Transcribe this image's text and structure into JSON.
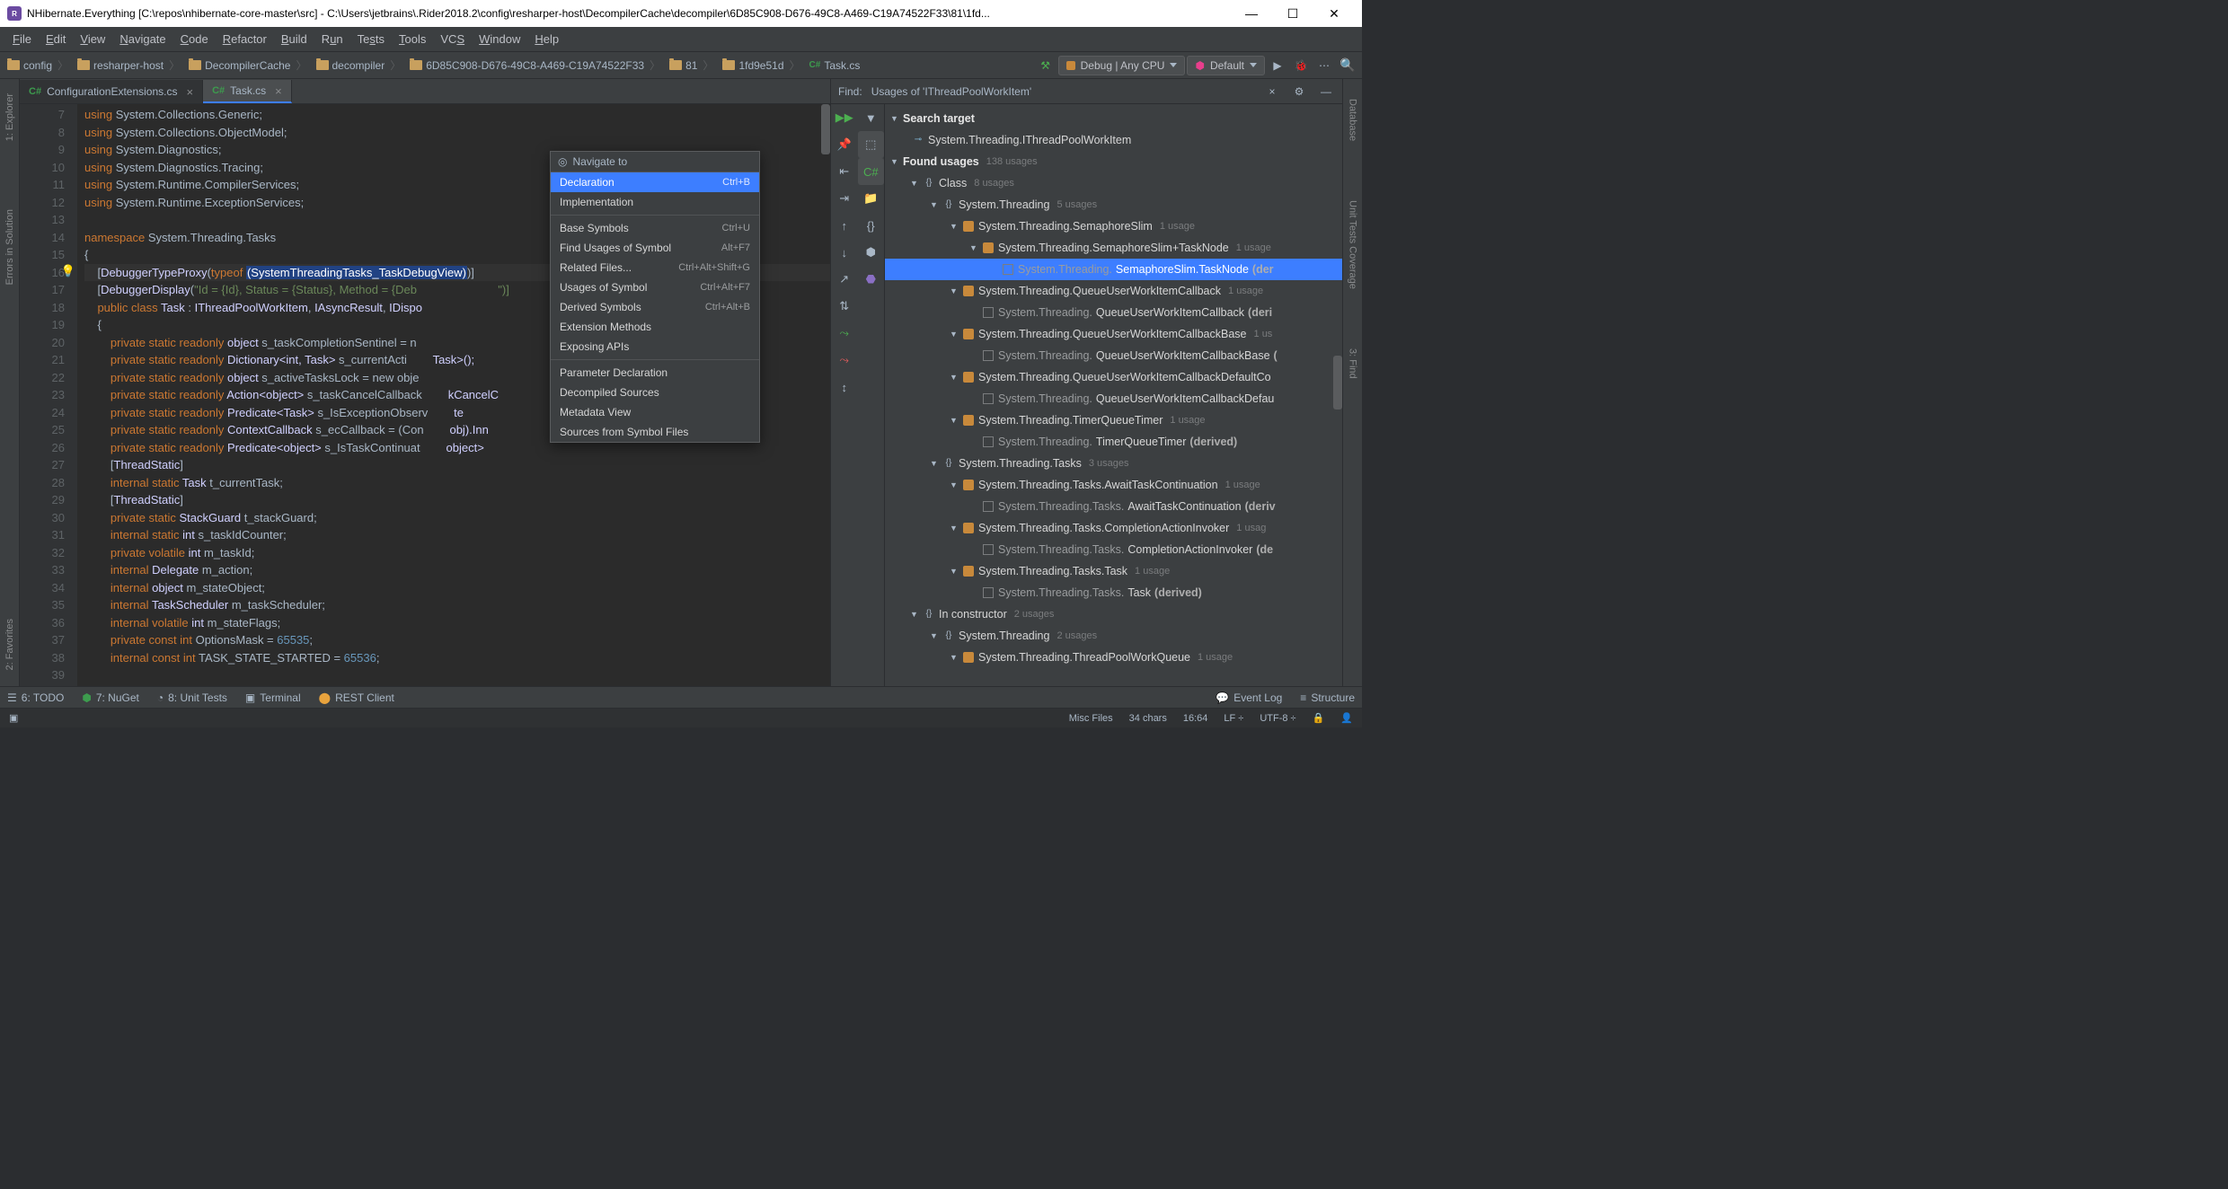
{
  "titlebar": {
    "title": "NHibernate.Everything [C:\\repos\\nhibernate-core-master\\src] - C:\\Users\\jetbrains\\.Rider2018.2\\config\\resharper-host\\DecompilerCache\\decompiler\\6D85C908-D676-49C8-A469-C19A74522F33\\81\\1fd..."
  },
  "menu": [
    "File",
    "Edit",
    "View",
    "Navigate",
    "Code",
    "Refactor",
    "Build",
    "Run",
    "Tests",
    "Tools",
    "VCS",
    "Window",
    "Help"
  ],
  "breadcrumbs": [
    "config",
    "resharper-host",
    "DecompilerCache",
    "decompiler",
    "6D85C908-D676-49C8-A469-C19A74522F33",
    "81",
    "1fd9e51d",
    "Task.cs"
  ],
  "runConfig": "Debug | Any CPU",
  "defaultConfig": "Default",
  "leftTools": [
    "1: Explorer",
    "Errors in Solution",
    "2: Favorites"
  ],
  "rightTools": [
    "Database",
    "Unit Tests Coverage",
    "3: Find"
  ],
  "tabs": [
    {
      "label": "ConfigurationExtensions.cs",
      "active": false
    },
    {
      "label": "Task.cs",
      "active": true
    }
  ],
  "gutterStart": 7,
  "gutterEnd": 39,
  "code": [
    {
      "t": "using System.Collections.Generic;",
      "k": "using"
    },
    {
      "t": "using System.Collections.ObjectModel;",
      "k": "using"
    },
    {
      "t": "using System.Diagnostics;",
      "k": "using"
    },
    {
      "t": "using System.Diagnostics.Tracing;",
      "k": "using"
    },
    {
      "t": "using System.Runtime.CompilerServices;",
      "k": "using"
    },
    {
      "t": "using System.Runtime.ExceptionServices;",
      "k": "using"
    },
    {
      "t": "",
      "k": ""
    },
    {
      "t": "namespace System.Threading.Tasks",
      "k": "ns"
    },
    {
      "t": "{",
      "k": ""
    },
    {
      "t": "    [DebuggerTypeProxy(typeof (SystemThreadingTasks_TaskDebugView))]",
      "k": "attr",
      "sel": "(SystemThreadingTasks_TaskDebugView)"
    },
    {
      "t": "    [DebuggerDisplay(\"Id = {Id}, Status = {Status}, Method = {Deb",
      "k": "attr2",
      "tail": "\")]"
    },
    {
      "t": "    public class Task : IThreadPoolWorkItem, IAsyncResult, IDispo",
      "k": "cls"
    },
    {
      "t": "    {",
      "k": ""
    },
    {
      "t": "        private static readonly object s_taskCompletionSentinel = n",
      "k": "f"
    },
    {
      "t": "        private static readonly Dictionary<int, Task> s_currentActi",
      "k": "f",
      "tail": "Task>();"
    },
    {
      "t": "        private static readonly object s_activeTasksLock = new obje",
      "k": "f"
    },
    {
      "t": "        private static readonly Action<object> s_taskCancelCallback",
      "k": "f",
      "tail": "kCancelC"
    },
    {
      "t": "        private static readonly Predicate<Task> s_IsExceptionObserv",
      "k": "f",
      "tail": "te<Task>"
    },
    {
      "t": "        private static readonly ContextCallback s_ecCallback = (Con",
      "k": "f",
      "tail": "obj).Inn"
    },
    {
      "t": "        private static readonly Predicate<object> s_IsTaskContinuat",
      "k": "f",
      "tail": "object>"
    },
    {
      "t": "        [ThreadStatic]",
      "k": "at"
    },
    {
      "t": "        internal static Task t_currentTask;",
      "k": "f2"
    },
    {
      "t": "        [ThreadStatic]",
      "k": "at"
    },
    {
      "t": "        private static StackGuard t_stackGuard;",
      "k": "f2"
    },
    {
      "t": "        internal static int s_taskIdCounter;",
      "k": "f2"
    },
    {
      "t": "        private volatile int m_taskId;",
      "k": "f2"
    },
    {
      "t": "        internal Delegate m_action;",
      "k": "f2"
    },
    {
      "t": "        internal object m_stateObject;",
      "k": "f2"
    },
    {
      "t": "        internal TaskScheduler m_taskScheduler;",
      "k": "f2"
    },
    {
      "t": "        internal volatile int m_stateFlags;",
      "k": "f2"
    },
    {
      "t": "        private const int OptionsMask = 65535;",
      "k": "f3"
    },
    {
      "t": "        internal const int TASK_STATE_STARTED = 65536;",
      "k": "f3"
    }
  ],
  "ctxMenu": {
    "title": "Navigate to",
    "items": [
      {
        "label": "Declaration",
        "sc": "Ctrl+B",
        "sel": true
      },
      {
        "label": "Implementation"
      },
      {
        "sep": true
      },
      {
        "label": "Base Symbols",
        "sc": "Ctrl+U"
      },
      {
        "label": "Find Usages of Symbol",
        "sc": "Alt+F7"
      },
      {
        "label": "Related Files...",
        "sc": "Ctrl+Alt+Shift+G"
      },
      {
        "label": "Usages of Symbol",
        "sc": "Ctrl+Alt+F7"
      },
      {
        "label": "Derived Symbols",
        "sc": "Ctrl+Alt+B"
      },
      {
        "label": "Extension Methods"
      },
      {
        "label": "Exposing APIs"
      },
      {
        "sep": true
      },
      {
        "label": "Parameter Declaration"
      },
      {
        "label": "Decompiled Sources"
      },
      {
        "label": "Metadata View"
      },
      {
        "label": "Sources from Symbol Files"
      }
    ]
  },
  "find": {
    "label": "Find:",
    "query": "Usages of 'IThreadPoolWorkItem'",
    "searchTargetLabel": "Search target",
    "searchTarget": "System.Threading.IThreadPoolWorkItem",
    "foundLabel": "Found usages",
    "foundCount": "138 usages",
    "tree": [
      {
        "ind": 1,
        "caret": "▼",
        "ic": "ns",
        "txt": "Class",
        "usage": "8 usages"
      },
      {
        "ind": 2,
        "caret": "▼",
        "ic": "ns",
        "txt": "System.Threading",
        "usage": "5 usages"
      },
      {
        "ind": 3,
        "caret": "▼",
        "ic": "cls",
        "txt": "System.Threading.SemaphoreSlim",
        "usage": "1 usage"
      },
      {
        "ind": 4,
        "caret": "▼",
        "ic": "cls",
        "txt": "System.Threading.SemaphoreSlim+TaskNode",
        "usage": "1 usage"
      },
      {
        "ind": 5,
        "caret": "",
        "ic": "chk",
        "pre": "System.Threading. ",
        "txt": "SemaphoreSlim.TaskNode",
        "post": " (der",
        "sel": true
      },
      {
        "ind": 3,
        "caret": "▼",
        "ic": "cls",
        "txt": "System.Threading.QueueUserWorkItemCallback",
        "usage": "1 usage"
      },
      {
        "ind": 4,
        "caret": "",
        "ic": "chk",
        "pre": "System.Threading. ",
        "txt": "QueueUserWorkItemCallback",
        "post": " (deri"
      },
      {
        "ind": 3,
        "caret": "▼",
        "ic": "cls",
        "txt": "System.Threading.QueueUserWorkItemCallbackBase",
        "usage": "1 us"
      },
      {
        "ind": 4,
        "caret": "",
        "ic": "chk",
        "pre": "System.Threading. ",
        "txt": "QueueUserWorkItemCallbackBase",
        "post": " ("
      },
      {
        "ind": 3,
        "caret": "▼",
        "ic": "cls",
        "txt": "System.Threading.QueueUserWorkItemCallbackDefaultCo",
        "usage": ""
      },
      {
        "ind": 4,
        "caret": "",
        "ic": "chk",
        "pre": "System.Threading. ",
        "txt": "QueueUserWorkItemCallbackDefau",
        "post": ""
      },
      {
        "ind": 3,
        "caret": "▼",
        "ic": "cls",
        "txt": "System.Threading.TimerQueueTimer",
        "usage": "1 usage"
      },
      {
        "ind": 4,
        "caret": "",
        "ic": "chk",
        "pre": "System.Threading. ",
        "txt": "TimerQueueTimer",
        "post": " (derived)"
      },
      {
        "ind": 2,
        "caret": "▼",
        "ic": "ns",
        "txt": "System.Threading.Tasks",
        "usage": "3 usages"
      },
      {
        "ind": 3,
        "caret": "▼",
        "ic": "cls",
        "txt": "System.Threading.Tasks.AwaitTaskContinuation",
        "usage": "1 usage"
      },
      {
        "ind": 4,
        "caret": "",
        "ic": "chk",
        "pre": "System.Threading.Tasks. ",
        "txt": "AwaitTaskContinuation",
        "post": " (deriv"
      },
      {
        "ind": 3,
        "caret": "▼",
        "ic": "cls",
        "txt": "System.Threading.Tasks.CompletionActionInvoker",
        "usage": "1 usag"
      },
      {
        "ind": 4,
        "caret": "",
        "ic": "chk",
        "pre": "System.Threading.Tasks. ",
        "txt": "CompletionActionInvoker",
        "post": " (de"
      },
      {
        "ind": 3,
        "caret": "▼",
        "ic": "cls",
        "txt": "System.Threading.Tasks.Task",
        "usage": "1 usage"
      },
      {
        "ind": 4,
        "caret": "",
        "ic": "chk",
        "pre": "System.Threading.Tasks. ",
        "txt": "Task",
        "post": " (derived)"
      },
      {
        "ind": 1,
        "caret": "▼",
        "ic": "ns",
        "txt": "In constructor",
        "usage": "2 usages"
      },
      {
        "ind": 2,
        "caret": "▼",
        "ic": "ns",
        "txt": "System.Threading",
        "usage": "2 usages"
      },
      {
        "ind": 3,
        "caret": "▼",
        "ic": "cls",
        "txt": "System.Threading.ThreadPoolWorkQueue",
        "usage": "1 usage"
      }
    ]
  },
  "bottom": [
    "6: TODO",
    "7: NuGet",
    "8: Unit Tests",
    "Terminal",
    "REST Client"
  ],
  "bottomRight": [
    "Event Log",
    "Structure"
  ],
  "status": {
    "left": "",
    "right": [
      "Misc Files",
      "34 chars",
      "16:64",
      "LF ÷",
      "UTF-8 ÷"
    ]
  }
}
